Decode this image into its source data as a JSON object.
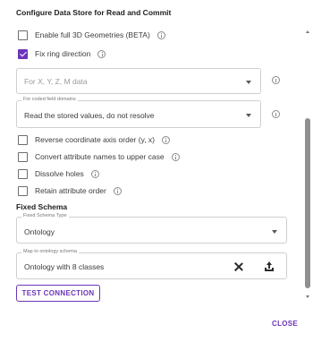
{
  "dialog": {
    "title": "Configure Data Store for Read and Commit",
    "close_label": "CLOSE"
  },
  "options": [
    {
      "label": "Enable full 3D Geometries (BETA)",
      "checked": false
    },
    {
      "label": "Fix ring direction",
      "checked": true
    }
  ],
  "xyzm_field": {
    "placeholder": "For X, Y, Z, M data"
  },
  "coded_domains_field": {
    "label": "For coded field domains",
    "value": "Read the stored values, do not resolve"
  },
  "options2": [
    {
      "label": "Reverse coordinate axis order (y, x)",
      "checked": false
    },
    {
      "label": "Convert attribute names to upper case",
      "checked": false
    },
    {
      "label": "Dissolve holes",
      "checked": false
    },
    {
      "label": "Retain attribute order",
      "checked": false
    }
  ],
  "fixed_schema": {
    "heading": "Fixed Schema",
    "type_label": "Fixed Schema Type",
    "type_value": "Ontology",
    "map_label": "Map to ontology schema",
    "map_value": "Ontology with 8 classes"
  },
  "test_connection_label": "TEST CONNECTION",
  "colors": {
    "accent": "#6a35b8",
    "border": "#cfcfcf",
    "text": "#3c3c3c"
  }
}
